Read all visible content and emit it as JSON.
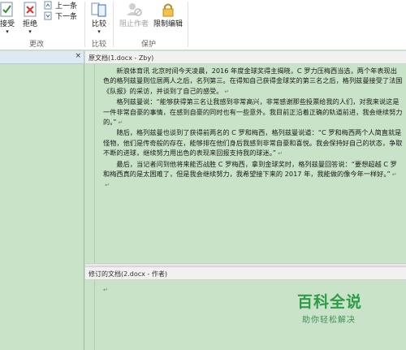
{
  "ribbon": {
    "accept_label": "接受",
    "reject_label": "拒绝",
    "previous_label": "上一条",
    "next_label": "下一条",
    "changes_group_label": "更改",
    "compare_label": "比较",
    "compare_group_label": "比较",
    "block_authors_label": "阻止作者",
    "restrict_editing_label": "限制编辑",
    "protect_group_label": "保护"
  },
  "left_panel": {
    "close_glyph": "×"
  },
  "original_doc": {
    "header": "原文档(1.docx - Zby)",
    "paragraphs": [
      "新浪体育讯  北京时间今天凌晨，2016 年度金球奖得主揭晓，C 罗力压梅西当选，两个年表现出色的格列兹曼则位居两人之后，名列第三。在得知自己获得金球奖的第三名之后，格列兹曼接受了法国《队报》的采访，并谈到了自己的感受。",
      "格列兹曼说：“能够获得第三名让我感到非常高兴，非常感谢那些投票给我的人们，对我来说这是一件非常自豪的事情，在感到自豪的同时也有一些意外。我目前正沿着正确的轨道前进，我会继续努力的。”",
      "随后，格列兹曼也谈到了获得前两名的 C 罗和梅西，格列兹曼说道：“C 罗和梅西两个人简直就是怪物，他们是传奇般的存在，能够排在他们身后我感到非常自豪和喜悦。我会保持好自己的状态，争取不断的进球，继续努力用出色的表现来回报支持我的球迷。”",
      "最后，当记者问到他将来能否战胜 C 罗梅西，拿到金球奖时，格列兹曼回答说：“要想超越 C 罗和梅西真的是太困难了，但是我会继续努力，我希望接下来的 2017 年，我能做的像今年一样好。”"
    ],
    "paragraph_mark": "↵",
    "end_mark": "↵"
  },
  "revised_doc": {
    "header": "修订的文档(2.docx - 作者)",
    "paragraph_mark": "↵"
  },
  "watermark": {
    "title": "百科全说",
    "subtitle": "助你轻松解决"
  },
  "colors": {
    "background_green": "#c9e3c8",
    "watermark_green": "#2e9b47",
    "reject_red": "#d9342b",
    "accent_blue": "#2b6cc4"
  }
}
